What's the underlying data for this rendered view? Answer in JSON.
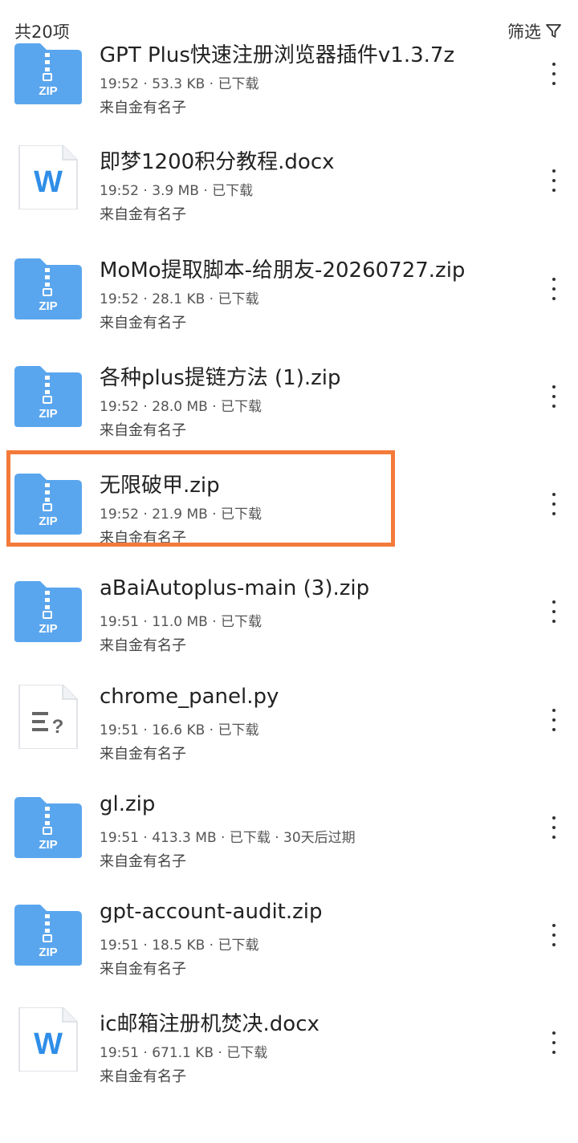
{
  "header": {
    "count_label": "共20项",
    "filter_label": "筛选"
  },
  "files": [
    {
      "name": "GPT Plus快速注册浏览器插件v1.3.7z",
      "meta": "19:52 · 53.3 KB · 已下载",
      "source": "来自金有名子",
      "type": "zip"
    },
    {
      "name": "即梦1200积分教程.docx",
      "meta": "19:52 · 3.9 MB · 已下载",
      "source": "来自金有名子",
      "type": "word"
    },
    {
      "name": "MoMo提取脚本-给朋友-20260727.zip",
      "meta": "19:52 · 28.1 KB · 已下载",
      "source": "来自金有名子",
      "type": "zip"
    },
    {
      "name": "各种plus提链方法 (1).zip",
      "meta": "19:52 · 28.0 MB · 已下载",
      "source": "来自金有名子",
      "type": "zip"
    },
    {
      "name": "无限破甲.zip",
      "meta": "19:52 · 21.9 MB · 已下载",
      "source": "来自金有名子",
      "type": "zip",
      "highlighted": true
    },
    {
      "name": "aBaiAutoplus-main (3).zip",
      "meta": "19:51 · 11.0 MB · 已下载",
      "source": "来自金有名子",
      "type": "zip"
    },
    {
      "name": "chrome_panel.py",
      "meta": "19:51 · 16.6 KB · 已下载",
      "source": "来自金有名子",
      "type": "unknown"
    },
    {
      "name": "gl.zip",
      "meta": "19:51 · 413.3 MB · 已下载 · 30天后过期",
      "source": "来自金有名子",
      "type": "zip"
    },
    {
      "name": "gpt-account-audit.zip",
      "meta": "19:51 · 18.5 KB · 已下载",
      "source": "来自金有名子",
      "type": "zip"
    },
    {
      "name": "ic邮箱注册机焚决.docx",
      "meta": "19:51 · 671.1 KB · 已下载",
      "source": "来自金有名子",
      "type": "word"
    }
  ],
  "icons": {
    "zip": {
      "name": "zip-folder-icon",
      "label": "ZIP",
      "color": "#5aa6ee"
    },
    "word": {
      "name": "word-document-icon",
      "label": "W",
      "color": "#2f8ee8"
    },
    "unknown": {
      "name": "unknown-file-icon",
      "label": "?",
      "color": "#666666"
    }
  },
  "colors": {
    "highlight_border": "#f47a3a"
  }
}
